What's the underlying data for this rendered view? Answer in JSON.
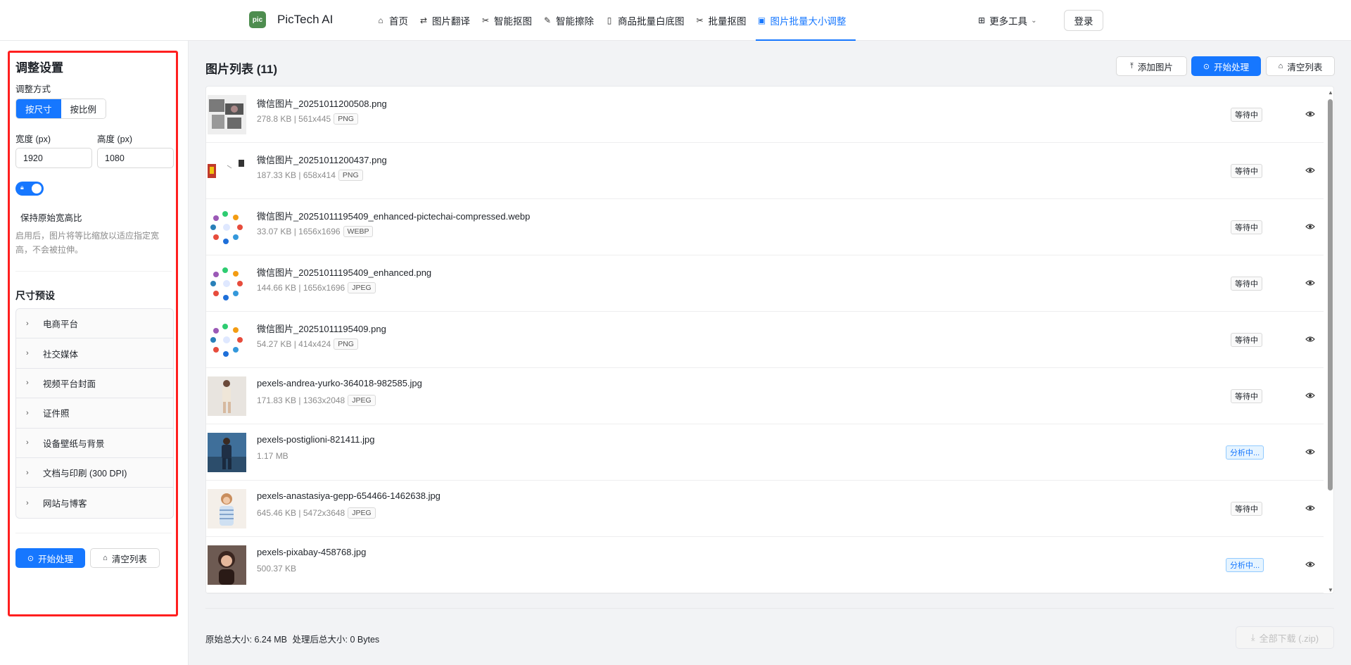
{
  "header": {
    "logo_mark": "pic",
    "app_name": "PicTech AI",
    "nav": [
      {
        "icon": "home-icon",
        "label": "首页"
      },
      {
        "icon": "translate-icon",
        "label": "图片翻译"
      },
      {
        "icon": "scissors-icon",
        "label": "智能抠图"
      },
      {
        "icon": "eraser-icon",
        "label": "智能擦除"
      },
      {
        "icon": "document-icon",
        "label": "商品批量白底图"
      },
      {
        "icon": "scissors-icon",
        "label": "批量抠图"
      },
      {
        "icon": "image-icon",
        "label": "图片批量大小调整",
        "active": true
      }
    ],
    "more_tools": "更多工具",
    "login": "登录"
  },
  "sidebar": {
    "title": "调整设置",
    "mode_label": "调整方式",
    "modes": [
      "按尺寸",
      "按比例"
    ],
    "width_label": "宽度 (px)",
    "height_label": "高度 (px)",
    "width_value": "1920",
    "height_value": "1080",
    "keep_ratio_label": "保持原始宽高比",
    "keep_ratio_hint": "启用后，图片将等比缩放以适应指定宽高，不会被拉伸。",
    "presets_title": "尺寸预设",
    "presets": [
      "电商平台",
      "社交媒体",
      "视频平台封面",
      "证件照",
      "设备壁纸与背景",
      "文档与印刷 (300 DPI)",
      "网站与博客"
    ],
    "start_button": "开始处理",
    "clear_button": "清空列表"
  },
  "main": {
    "title": "图片列表 (11)",
    "add_button": "添加图片",
    "start_button": "开始处理",
    "clear_button": "清空列表",
    "files": [
      {
        "name": "微信图片_20251011200508.png",
        "info": "278.8 KB | 561x445",
        "format": "PNG",
        "status": "等待中",
        "thumb": "photo-collage"
      },
      {
        "name": "微信图片_20251011200437.png",
        "info": "187.33 KB | 658x414",
        "format": "PNG",
        "status": "等待中",
        "thumb": "product-sketch"
      },
      {
        "name": "微信图片_20251011195409_enhanced-pictechai-compressed.webp",
        "info": "33.07 KB | 1656x1696",
        "format": "WEBP",
        "status": "等待中",
        "thumb": "icon-ring"
      },
      {
        "name": "微信图片_20251011195409_enhanced.png",
        "info": "144.66 KB | 1656x1696",
        "format": "JPEG",
        "status": "等待中",
        "thumb": "icon-ring"
      },
      {
        "name": "微信图片_20251011195409.png",
        "info": "54.27 KB | 414x424",
        "format": "PNG",
        "status": "等待中",
        "thumb": "icon-ring"
      },
      {
        "name": "pexels-andrea-yurko-364018-982585.jpg",
        "info": "171.83 KB | 1363x2048",
        "format": "JPEG",
        "status": "等待中",
        "thumb": "person-beige"
      },
      {
        "name": "pexels-postiglioni-821411.jpg",
        "info": "1.17 MB",
        "format": "",
        "status": "分析中...",
        "thumb": "person-denim"
      },
      {
        "name": "pexels-anastasiya-gepp-654466-1462638.jpg",
        "info": "645.46 KB | 5472x3648",
        "format": "JPEG",
        "status": "等待中",
        "thumb": "person-stripe"
      },
      {
        "name": "pexels-pixabay-458768.jpg",
        "info": "500.37 KB",
        "format": "",
        "status": "分析中...",
        "thumb": "person-portrait"
      }
    ],
    "footer_original_label": "原始总大小:",
    "footer_original_value": "6.24 MB",
    "footer_processed_label": "处理后总大小:",
    "footer_processed_value": "0 Bytes",
    "download_button": "全部下载 (.zip)"
  },
  "colors": {
    "accent": "#1677ff",
    "highlight": "#ff1f1f",
    "logo": "#4e8d4f"
  }
}
